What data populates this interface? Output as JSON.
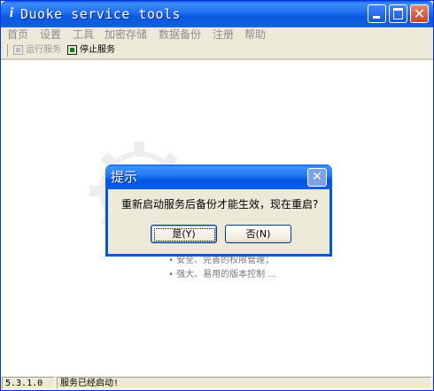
{
  "window": {
    "title": "Duoke service tools",
    "icon": "app-i-icon",
    "close_glyph": "✕"
  },
  "menu": {
    "items": [
      {
        "label": "首页"
      },
      {
        "label": "设置"
      },
      {
        "label": "工具"
      },
      {
        "label": "加密存储"
      },
      {
        "label": "数据备份"
      },
      {
        "label": "注册"
      },
      {
        "label": "帮助"
      }
    ]
  },
  "toolbar": {
    "run_label": "运行服务",
    "stop_label": "停止服务"
  },
  "content": {
    "bullets": [
      "• 安全、完善的权限管理；",
      "• 强大、易用的版本控制 ..."
    ]
  },
  "dialog": {
    "title": "提示",
    "close_glyph": "✕",
    "message": "重新启动服务后备份才能生效，现在重启?",
    "yes_label": "是(Y)",
    "no_label": "否(N)"
  },
  "status": {
    "version": "5.3.1.0",
    "message": "服务已经启动!"
  },
  "colors": {
    "titlebar": "#0a58e0",
    "window_face": "#ece9d8",
    "disabled_text": "#8d8d8d"
  }
}
